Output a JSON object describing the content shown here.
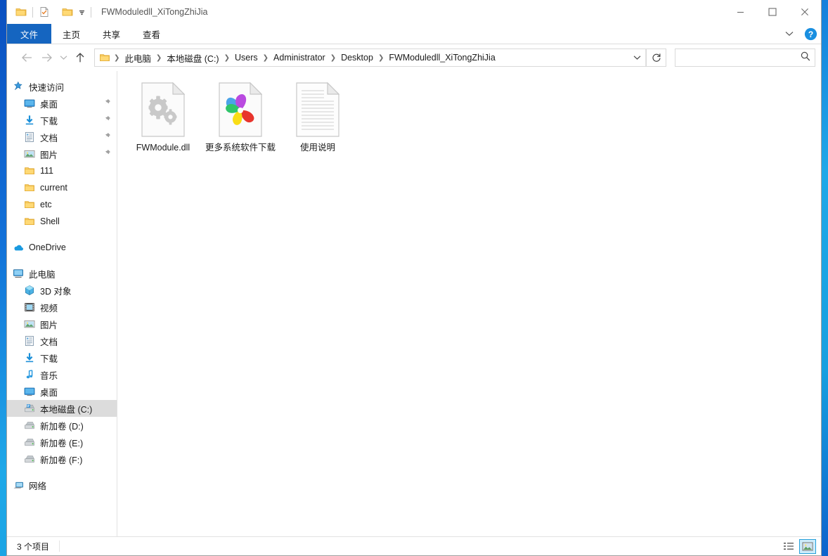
{
  "window": {
    "title": "FWModuledll_XiTongZhiJia",
    "quick_access": [
      {
        "name": "folder-icon",
        "label": "文件夹"
      },
      {
        "name": "properties-icon",
        "label": "属性"
      },
      {
        "name": "new-folder-icon",
        "label": "新建文件夹"
      }
    ],
    "controls": {
      "minimize": "─",
      "maximize": "□",
      "close": "✕"
    }
  },
  "ribbon": {
    "tabs": [
      {
        "label": "文件",
        "active": true
      },
      {
        "label": "主页",
        "active": false
      },
      {
        "label": "共享",
        "active": false
      },
      {
        "label": "查看",
        "active": false
      }
    ],
    "expand_icon": "chevron-down-icon",
    "help_icon": "help-icon",
    "help_label": "?"
  },
  "address": {
    "back_label": "←",
    "forward_label": "→",
    "recent_label": "⌄",
    "up_label": "↑",
    "breadcrumbs": [
      "此电脑",
      "本地磁盘 (C:)",
      "Users",
      "Administrator",
      "Desktop",
      "FWModuledll_XiTongZhiJia"
    ],
    "separator": "❯",
    "dropdown_label": "⌄",
    "refresh_label": "↻"
  },
  "search": {
    "value": "",
    "placeholder": "",
    "icon": "search-icon"
  },
  "sidebar": {
    "groups": [
      {
        "header": {
          "label": "快速访问",
          "icon": "star-pin-icon",
          "level": 0
        },
        "items": [
          {
            "label": "桌面",
            "icon": "desktop-icon",
            "pinned": true,
            "level": 1
          },
          {
            "label": "下载",
            "icon": "download-icon",
            "pinned": true,
            "level": 1
          },
          {
            "label": "文档",
            "icon": "documents-icon",
            "pinned": true,
            "level": 1
          },
          {
            "label": "图片",
            "icon": "pictures-icon",
            "pinned": true,
            "level": 1
          },
          {
            "label": "111",
            "icon": "folder-icon",
            "pinned": false,
            "level": 1
          },
          {
            "label": "current",
            "icon": "folder-icon",
            "pinned": false,
            "level": 1
          },
          {
            "label": "etc",
            "icon": "folder-icon",
            "pinned": false,
            "level": 1
          },
          {
            "label": "Shell",
            "icon": "folder-icon",
            "pinned": false,
            "level": 1
          }
        ]
      },
      {
        "header": {
          "label": "OneDrive",
          "icon": "onedrive-icon",
          "level": 0
        },
        "items": []
      },
      {
        "header": {
          "label": "此电脑",
          "icon": "this-pc-icon",
          "level": 0
        },
        "items": [
          {
            "label": "3D 对象",
            "icon": "3d-objects-icon",
            "pinned": false,
            "level": 1
          },
          {
            "label": "视频",
            "icon": "videos-icon",
            "pinned": false,
            "level": 1
          },
          {
            "label": "图片",
            "icon": "pictures-icon",
            "pinned": false,
            "level": 1
          },
          {
            "label": "文档",
            "icon": "documents-icon",
            "pinned": false,
            "level": 1
          },
          {
            "label": "下载",
            "icon": "download-icon",
            "pinned": false,
            "level": 1
          },
          {
            "label": "音乐",
            "icon": "music-icon",
            "pinned": false,
            "level": 1
          },
          {
            "label": "桌面",
            "icon": "desktop-icon",
            "pinned": false,
            "level": 1
          },
          {
            "label": "本地磁盘 (C:)",
            "icon": "drive-system-icon",
            "pinned": false,
            "level": 1,
            "selected": true
          },
          {
            "label": "新加卷 (D:)",
            "icon": "drive-icon",
            "pinned": false,
            "level": 1
          },
          {
            "label": "新加卷 (E:)",
            "icon": "drive-icon",
            "pinned": false,
            "level": 1
          },
          {
            "label": "新加卷 (F:)",
            "icon": "drive-icon",
            "pinned": false,
            "level": 1
          }
        ]
      },
      {
        "header": {
          "label": "网络",
          "icon": "network-icon",
          "level": 0
        },
        "items": []
      }
    ]
  },
  "files": [
    {
      "label": "FWModule.dll",
      "icon": "dll-file-icon"
    },
    {
      "label": "更多系统软件下载",
      "icon": "browser-shortcut-icon"
    },
    {
      "label": "使用说明",
      "icon": "text-file-icon"
    }
  ],
  "statusbar": {
    "item_count": "3 个项目",
    "views": [
      {
        "name": "details-view",
        "active": false
      },
      {
        "name": "large-icons-view",
        "active": true
      }
    ]
  },
  "colors": {
    "accent": "#1565c0",
    "file_tab": "#1565c0",
    "selection": "#dcdcdc",
    "folder_yellow": "#ffca28",
    "help_blue": "#1a8fe0"
  }
}
